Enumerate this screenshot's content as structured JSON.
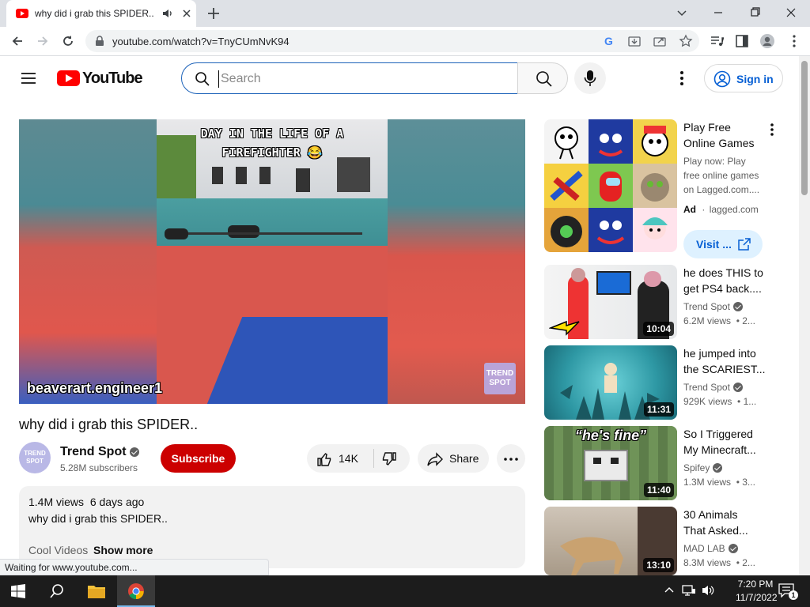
{
  "browser": {
    "tab_title": "why did i grab this SPIDER..",
    "url": "youtube.com/watch?v=TnyCUmNvK94",
    "status": "Waiting for www.youtube.com..."
  },
  "header": {
    "logo_text": "YouTube",
    "search_placeholder": "Search",
    "signin_label": "Sign in"
  },
  "video": {
    "overlay_text_line1": "DAY IN THE LIFE OF A",
    "overlay_text_line2": "FIREFIGHTER 😂",
    "watermark": "beaverart.engineer1",
    "logo_line1": "TREND",
    "logo_line2": "SPOT",
    "title": "why did i grab this SPIDER..",
    "channel_name": "Trend Spot",
    "avatar_line1": "TREND",
    "avatar_line2": "SPOT",
    "subscribers": "5.28M subscribers",
    "subscribe_label": "Subscribe",
    "likes": "14K",
    "share_label": "Share"
  },
  "description": {
    "views": "1.4M views",
    "date": "6 days ago",
    "line1": "why did i grab this SPIDER..",
    "line2": "Cool Videos",
    "show_more": "Show more"
  },
  "ad": {
    "title_line1": "Play Free",
    "title_line2": "Online Games",
    "desc_line1": "Play now: Play",
    "desc_line2": "free online games",
    "desc_line3": "on Lagged.com....",
    "ad_badge": "Ad",
    "domain": "lagged.com",
    "visit_label": "Visit ..."
  },
  "recommendations": [
    {
      "title_line1": "he does THIS to",
      "title_line2": "get PS4 back....",
      "channel": "Trend Spot",
      "views": "6.2M views",
      "age": "• 2...",
      "duration": "10:04"
    },
    {
      "title_line1": "he jumped into",
      "title_line2": "the SCARIEST...",
      "channel": "Trend Spot",
      "views": "929K views",
      "age": "• 1...",
      "duration": "11:31"
    },
    {
      "title_line1": "So I Triggered",
      "title_line2": "My Minecraft...",
      "channel": "Spifey",
      "views": "1.3M views",
      "age": "• 3...",
      "duration": "11:40",
      "thumb_text": "“he's fine”"
    },
    {
      "title_line1": "30 Animals",
      "title_line2": "That Asked...",
      "channel": "MAD LAB",
      "views": "8.3M views",
      "age": "• 2...",
      "duration": "13:10"
    }
  ],
  "taskbar": {
    "time": "7:20 PM",
    "date": "11/7/2022",
    "notification_count": "1"
  },
  "colors": {
    "youtube_red": "#ff0000",
    "subscribe_red": "#cc0000",
    "link_blue": "#065fd4",
    "taskbar": "#1c1c1c"
  }
}
